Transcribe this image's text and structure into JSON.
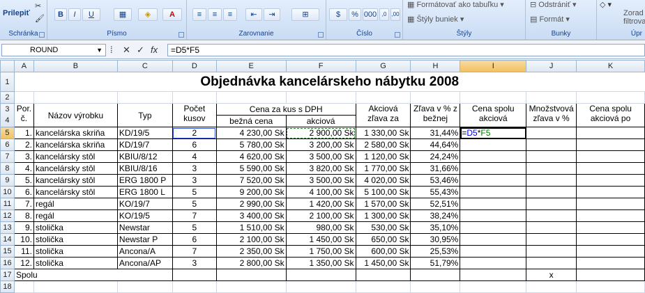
{
  "ribbon": {
    "paste_label": "Prilepiť",
    "clipboard_label": "Schránka",
    "font_label": "Písmo",
    "align_label": "Zarovnanie",
    "number_label": "Číslo",
    "styles_label": "Štýly",
    "cells_label": "Bunky",
    "editing_label": "Úpr",
    "bold": "B",
    "italic": "I",
    "underline": "U",
    "format_table": "Formátovať ako tabuľku",
    "cell_styles": "Štýly buniek",
    "delete": "Odstrániť",
    "format": "Formát",
    "sort": "Zorad",
    "filter": "filtrova",
    "percent": "%",
    "thousands": "000",
    "dec_inc": ",0",
    "dec_dec": ",00"
  },
  "formula_bar": {
    "name_box": "ROUND",
    "fx": "fx",
    "formula": "=D5*F5"
  },
  "columns": [
    "A",
    "B",
    "C",
    "D",
    "E",
    "F",
    "G",
    "H",
    "I",
    "J",
    "K"
  ],
  "title": "Objednávka kancelárskeho nábytku 2008",
  "headers": {
    "por": "Por. č.",
    "nazov": "Názov výrobku",
    "typ": "Typ",
    "pocet": "Počet kusov",
    "cena_za_kus": "Cena za kus s DPH",
    "bezna": "bežná cena",
    "akciova": "akciová",
    "akciova_zlava": "Akciová zľava za",
    "zlava_pct": "Zľava v % z bežnej",
    "cena_spolu": "Cena spolu akciová",
    "mnozstvova": "Množstvová zľava v %",
    "cena_spolu_po": "Cena spolu akciová po"
  },
  "rows": [
    {
      "n": "1.",
      "nazov": "kancelárska skriňa",
      "typ": "KD/19/5",
      "pocet": "2",
      "bezna": "4 230,00 Sk",
      "akciova": "2 900,00 Sk",
      "zlava": "1 330,00 Sk",
      "pct": "31,44%"
    },
    {
      "n": "2.",
      "nazov": "kancelárska skriňa",
      "typ": "KD/19/7",
      "pocet": "6",
      "bezna": "5 780,00 Sk",
      "akciova": "3 200,00 Sk",
      "zlava": "2 580,00 Sk",
      "pct": "44,64%"
    },
    {
      "n": "3.",
      "nazov": "kancelársky stôl",
      "typ": "KBIU/8/12",
      "pocet": "4",
      "bezna": "4 620,00 Sk",
      "akciova": "3 500,00 Sk",
      "zlava": "1 120,00 Sk",
      "pct": "24,24%"
    },
    {
      "n": "4.",
      "nazov": "kancelársky stôl",
      "typ": "KBIU/8/16",
      "pocet": "3",
      "bezna": "5 590,00 Sk",
      "akciova": "3 820,00 Sk",
      "zlava": "1 770,00 Sk",
      "pct": "31,66%"
    },
    {
      "n": "5.",
      "nazov": "kancelársky stôl",
      "typ": "ERG 1800 P",
      "pocet": "3",
      "bezna": "7 520,00 Sk",
      "akciova": "3 500,00 Sk",
      "zlava": "4 020,00 Sk",
      "pct": "53,46%"
    },
    {
      "n": "6.",
      "nazov": "kancelársky stôl",
      "typ": "ERG 1800 L",
      "pocet": "5",
      "bezna": "9 200,00 Sk",
      "akciova": "4 100,00 Sk",
      "zlava": "5 100,00 Sk",
      "pct": "55,43%"
    },
    {
      "n": "7.",
      "nazov": "regál",
      "typ": "KO/19/7",
      "pocet": "5",
      "bezna": "2 990,00 Sk",
      "akciova": "1 420,00 Sk",
      "zlava": "1 570,00 Sk",
      "pct": "52,51%"
    },
    {
      "n": "8.",
      "nazov": "regál",
      "typ": "KO/19/5",
      "pocet": "7",
      "bezna": "3 400,00 Sk",
      "akciova": "2 100,00 Sk",
      "zlava": "1 300,00 Sk",
      "pct": "38,24%"
    },
    {
      "n": "9.",
      "nazov": "stolička",
      "typ": "Newstar",
      "pocet": "5",
      "bezna": "1 510,00 Sk",
      "akciova": "980,00 Sk",
      "zlava": "530,00 Sk",
      "pct": "35,10%"
    },
    {
      "n": "10.",
      "nazov": "stolička",
      "typ": "Newstar P",
      "pocet": "6",
      "bezna": "2 100,00 Sk",
      "akciova": "1 450,00 Sk",
      "zlava": "650,00 Sk",
      "pct": "30,95%"
    },
    {
      "n": "11.",
      "nazov": "stolička",
      "typ": "Ancona/A",
      "pocet": "7",
      "bezna": "2 350,00 Sk",
      "akciova": "1 750,00 Sk",
      "zlava": "600,00 Sk",
      "pct": "25,53%"
    },
    {
      "n": "12.",
      "nazov": "stolička",
      "typ": "Ancona/AP",
      "pocet": "3",
      "bezna": "2 800,00 Sk",
      "akciova": "1 350,00 Sk",
      "zlava": "1 450,00 Sk",
      "pct": "51,79%"
    }
  ],
  "spolu": "Spolu",
  "x_mark": "x",
  "edit_cell": {
    "part1": "=",
    "ref1": "D5",
    "op": "*",
    "ref2": "F5"
  }
}
